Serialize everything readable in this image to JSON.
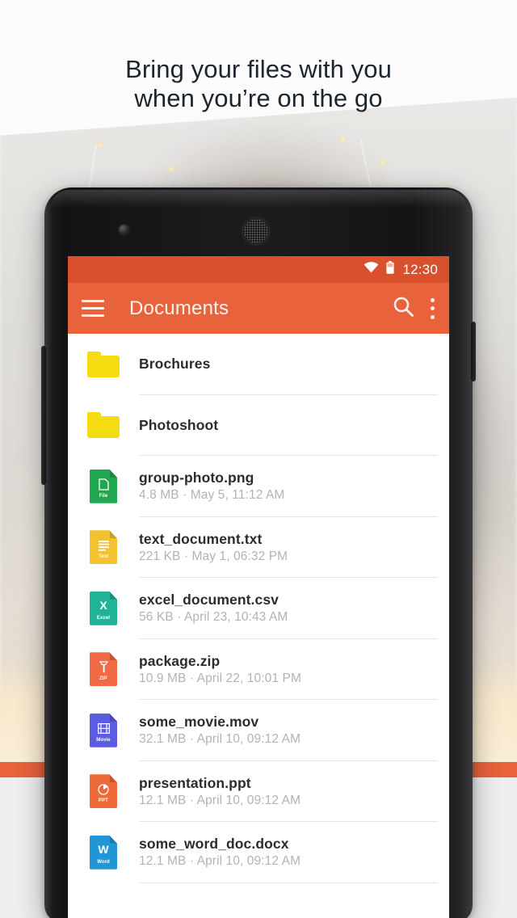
{
  "promo": {
    "headline_line1": "Bring your files with you",
    "headline_line2": "when you’re on the go"
  },
  "colors": {
    "accent": "#e8623c",
    "statusbar": "#d9512c",
    "folder": "#f4dc10",
    "band": "#e8623c",
    "headline_text": "#1c2430",
    "filename_text": "#2c2c2c",
    "meta_text": "#b3b3b3"
  },
  "statusbar": {
    "time": "12:30",
    "wifi_icon": "wifi-icon",
    "battery_icon": "battery-icon"
  },
  "appbar": {
    "title": "Documents",
    "menu_icon": "hamburger-menu-icon",
    "search_icon": "search-icon",
    "overflow_icon": "overflow-menu-icon"
  },
  "files": [
    {
      "name": "Brochures",
      "meta": "",
      "kind": "folder",
      "icon": "folder-icon",
      "tag": "",
      "glyph": "",
      "color": "#f4dc10"
    },
    {
      "name": "Photoshoot",
      "meta": "",
      "kind": "folder",
      "icon": "folder-icon",
      "tag": "",
      "glyph": "",
      "color": "#f4dc10"
    },
    {
      "name": "group-photo.png",
      "meta": "4.8 MB · May 5, 11:12 AM",
      "kind": "file",
      "icon": "file-image-icon",
      "tag": "File",
      "glyph": "doc",
      "color": "#1fa84f"
    },
    {
      "name": "text_document.txt",
      "meta": "221 KB · May 1, 06:32 PM",
      "kind": "file",
      "icon": "file-text-icon",
      "tag": "Text",
      "glyph": "lines",
      "color": "#f2c230"
    },
    {
      "name": "excel_document.csv",
      "meta": "56 KB · April 23, 10:43 AM",
      "kind": "file",
      "icon": "file-excel-icon",
      "tag": "Excel",
      "glyph": "X",
      "color": "#20b395"
    },
    {
      "name": "package.zip",
      "meta": "10.9 MB · April 22, 10:01 PM",
      "kind": "file",
      "icon": "file-zip-icon",
      "tag": "ZIP",
      "glyph": "zip",
      "color": "#ef6a45"
    },
    {
      "name": "some_movie.mov",
      "meta": "32.1 MB · April 10, 09:12 AM",
      "kind": "file",
      "icon": "file-movie-icon",
      "tag": "Movie",
      "glyph": "film",
      "color": "#5b5ce0"
    },
    {
      "name": "presentation.ppt",
      "meta": "12.1 MB · April 10, 09:12 AM",
      "kind": "file",
      "icon": "file-powerpoint-icon",
      "tag": "PPT",
      "glyph": "pie",
      "color": "#ee6a38"
    },
    {
      "name": "some_word_doc.docx",
      "meta": "12.1 MB · April 10, 09:12 AM",
      "kind": "file",
      "icon": "file-word-icon",
      "tag": "Word",
      "glyph": "W",
      "color": "#2196d6"
    }
  ]
}
